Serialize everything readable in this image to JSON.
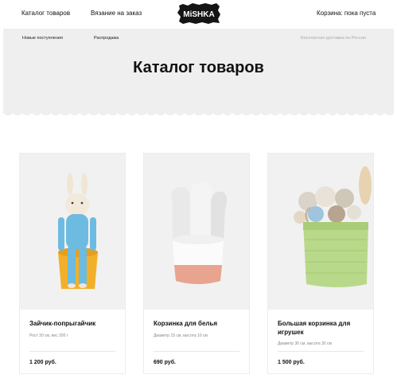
{
  "header": {
    "nav_catalog": "Каталог товаров",
    "nav_knitting": "Вязание на заказ",
    "logo_text": "MiSHKA",
    "cart": "Корзина: пока пуста"
  },
  "subnav": {
    "new_arrivals": "Новые поступления",
    "sale": "Распродажа",
    "delivery": "Бесплатная доставка по России"
  },
  "page": {
    "title": "Каталог товаров"
  },
  "products": [
    {
      "name": "Зайчик-попрыгайчик",
      "desc": "Рост 30 см, вес 200 г",
      "price": "1 200 руб."
    },
    {
      "name": "Корзинка для белья",
      "desc": "Диаметр 15 см, высота 10 см",
      "price": "690 руб."
    },
    {
      "name": "Большая корзинка для игрушек",
      "desc": "Диаметр 30 см, высота 30 см",
      "price": "1 500 руб."
    }
  ],
  "colors": {
    "hero_bg": "#efefef",
    "basket_pink": "#e8a48e",
    "basket_green": "#b9d98a",
    "bunny_blue": "#6dbbe0",
    "pot_yellow": "#f2b02a"
  }
}
